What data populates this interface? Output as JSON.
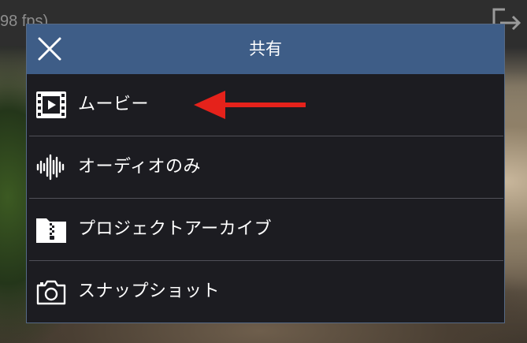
{
  "background": {
    "fps_text": "98 fps)",
    "share_icon": "share-export-icon"
  },
  "dialog": {
    "title": "共有",
    "close_icon": "close-icon",
    "header_color": "#3e5d87",
    "items": [
      {
        "label": "ムービー",
        "icon": "film-icon"
      },
      {
        "label": "オーディオのみ",
        "icon": "audio-waveform-icon"
      },
      {
        "label": "プロジェクトアーカイブ",
        "icon": "zip-folder-icon"
      },
      {
        "label": "スナップショット",
        "icon": "camera-icon"
      }
    ]
  },
  "annotation": {
    "arrow_color": "#e5221b",
    "points_to": "ムービー"
  }
}
